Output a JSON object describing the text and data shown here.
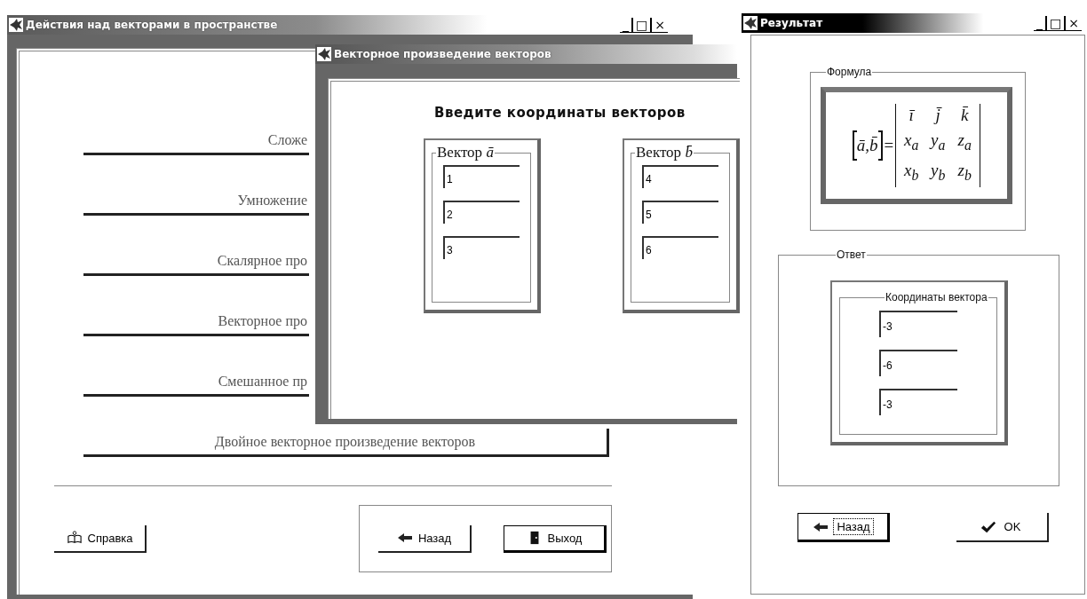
{
  "main_window": {
    "title": "Действия над векторами в пространстве",
    "controls": [
      "_",
      "□",
      "×"
    ],
    "menu": [
      {
        "label": "Сложе",
        "cut": true
      },
      {
        "label": "Умножение",
        "cut": true
      },
      {
        "label": "Скалярное про",
        "cut": true
      },
      {
        "label": "Векторное про",
        "cut": true
      },
      {
        "label": "Смешанное пр",
        "cut": true
      },
      {
        "label": "Двойное векторное произведение векторов",
        "cut": false
      }
    ],
    "help_button": {
      "label": "Справка"
    },
    "buttons": [
      {
        "label": "Назад",
        "kind": "back",
        "default": false
      },
      {
        "label": "Выход",
        "kind": "exit",
        "default": true
      }
    ]
  },
  "cross_window": {
    "title": "Векторное произведение векторов",
    "heading": "Введите координаты векторов",
    "vectors": [
      {
        "label": "Вектор *ā*",
        "values": [
          "1",
          "2",
          "3"
        ]
      },
      {
        "label": "Вектор *b̄*",
        "values": [
          "4",
          "5",
          "6"
        ]
      }
    ]
  },
  "result_window": {
    "title": "Результат",
    "controls": [
      "_",
      "□",
      "×"
    ],
    "formula_group": "Формула",
    "formula": {
      "lhs": "ā,b̄",
      "equals": "=",
      "matrix": [
        [
          "ī",
          "j̄",
          "k̄"
        ],
        [
          "x$_{a}$",
          "y$_{a}$",
          "z$_{a}$"
        ],
        [
          "x$_{b}$",
          "y$_{b}$",
          "z$_{b}$"
        ]
      ]
    },
    "answer_group": "Ответ",
    "coords_group": "Координаты вектора",
    "values": [
      "-3",
      "-6",
      "-3"
    ],
    "buttons": [
      {
        "label": "Назад",
        "kind": "back",
        "focused": true
      },
      {
        "label": "OK",
        "kind": "ok",
        "focused": false
      }
    ]
  }
}
